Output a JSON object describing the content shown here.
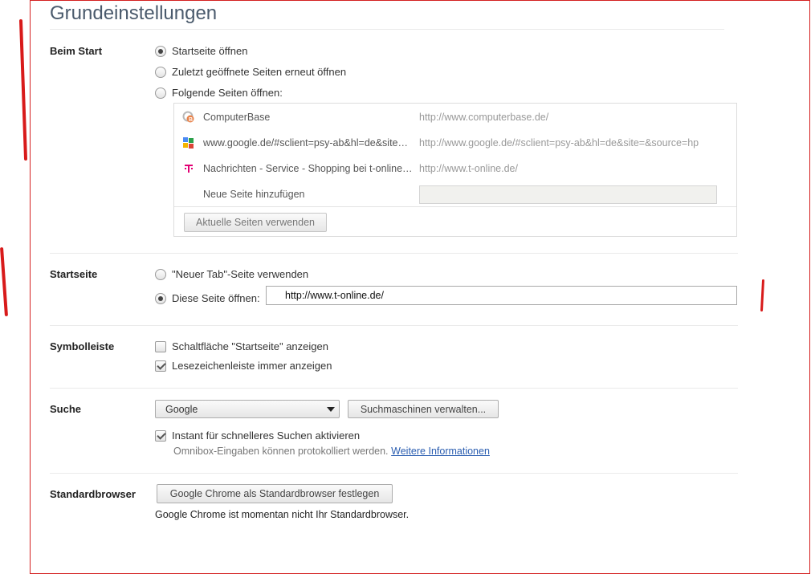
{
  "title": "Grundeinstellungen",
  "beim_start": {
    "label": "Beim Start",
    "options": [
      "Startseite öffnen",
      "Zuletzt geöffnete Seiten erneut öffnen",
      "Folgende Seiten öffnen:"
    ],
    "selected": 0,
    "pages": [
      {
        "name": "ComputerBase",
        "url": "http://www.computerbase.de/",
        "icon": "computerbase-favicon"
      },
      {
        "name": "www.google.de/#sclient=psy-ab&hl=de&site=&source=hp",
        "url": "http://www.google.de/#sclient=psy-ab&hl=de&site=&source=hp",
        "icon": "google-favicon"
      },
      {
        "name": "Nachrichten - Service - Shopping bei t-online.de",
        "url": "http://www.t-online.de/",
        "icon": "telekom-favicon"
      }
    ],
    "new_page_label": "Neue Seite hinzufügen",
    "use_current_button": "Aktuelle Seiten verwenden"
  },
  "startseite": {
    "label": "Startseite",
    "options": [
      "\"Neuer Tab\"-Seite verwenden",
      "Diese Seite öffnen:"
    ],
    "selected": 1,
    "url_value": "http://www.t-online.de/"
  },
  "symbolleiste": {
    "label": "Symbolleiste",
    "checkboxes": [
      {
        "label": "Schaltfläche \"Startseite\" anzeigen",
        "checked": false
      },
      {
        "label": "Lesezeichenleiste immer anzeigen",
        "checked": true
      }
    ]
  },
  "suche": {
    "label": "Suche",
    "engine": "Google",
    "manage_button": "Suchmaschinen verwalten...",
    "instant_label": "Instant für schnelleres Suchen aktivieren",
    "instant_checked": true,
    "hint_text": "Omnibox-Eingaben können protokolliert werden.",
    "hint_link": "Weitere Informationen"
  },
  "standardbrowser": {
    "label": "Standardbrowser",
    "button": "Google Chrome als Standardbrowser festlegen",
    "status": "Google Chrome ist momentan nicht Ihr Standardbrowser."
  },
  "colors": {
    "frame": "#d41f1f",
    "title": "#4a5a6c",
    "link": "#2a5db0"
  }
}
